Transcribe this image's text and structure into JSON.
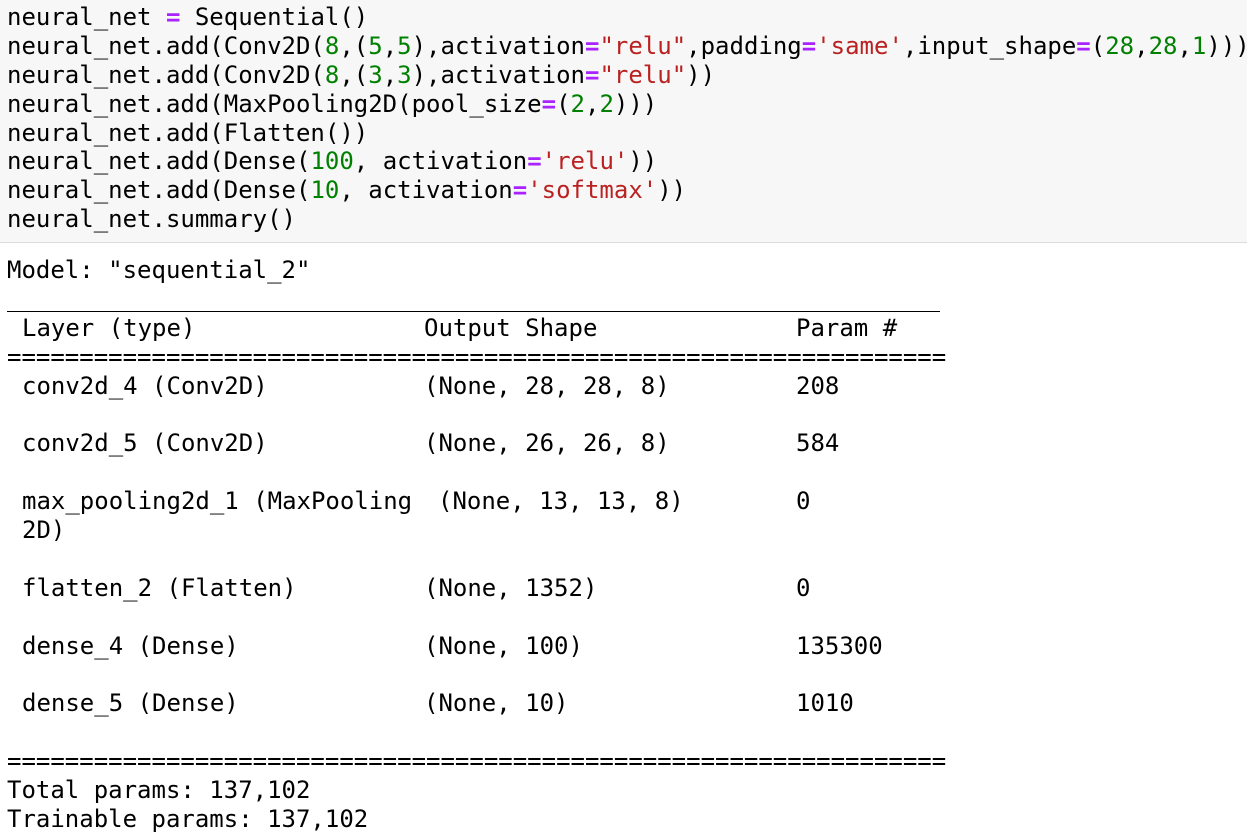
{
  "code": {
    "line1": {
      "a": "neural_net ",
      "op": "=",
      "b": " Sequential()"
    },
    "line2": {
      "p1": "neural_net.add(Conv2D(",
      "n1": "8",
      "p2": ",(",
      "n2": "5",
      "p3": ",",
      "n3": "5",
      "p4": "),activation",
      "op1": "=",
      "s1": "\"relu\"",
      "p5": ",padding",
      "op2": "=",
      "s2": "'same'",
      "p6": ",input_shape",
      "op3": "=",
      "p7": "(",
      "n4": "28",
      "p8": ",",
      "n5": "28",
      "p9": ",",
      "n6": "1",
      "p10": ")))"
    },
    "line3": {
      "p1": "neural_net.add(Conv2D(",
      "n1": "8",
      "p2": ",(",
      "n2": "3",
      "p3": ",",
      "n3": "3",
      "p4": "),activation",
      "op1": "=",
      "s1": "\"relu\"",
      "p5": "))"
    },
    "line4": {
      "p1": "neural_net.add(MaxPooling2D(pool_size",
      "op1": "=",
      "p2": "(",
      "n1": "2",
      "p3": ",",
      "n2": "2",
      "p4": ")))"
    },
    "line5": {
      "p1": "neural_net.add(Flatten())"
    },
    "line6": {
      "p1": "neural_net.add(Dense(",
      "n1": "100",
      "p2": ", activation",
      "op1": "=",
      "s1": "'relu'",
      "p3": "))"
    },
    "line7": {
      "p1": "neural_net.add(Dense(",
      "n1": "10",
      "p2": ", activation",
      "op1": "=",
      "s1": "'softmax'",
      "p3": "))"
    },
    "line8": {
      "p1": "neural_net.summary()"
    }
  },
  "output": {
    "model_line": "Model: \"sequential_2\"",
    "header": {
      "layer": "Layer (type)",
      "shape": "Output Shape",
      "params": "Param #"
    },
    "double_rule": "=================================================================",
    "rows": [
      {
        "layer": "conv2d_4 (Conv2D)",
        "shape": "(None, 28, 28, 8)",
        "params": "208"
      },
      {
        "layer": "conv2d_5 (Conv2D)",
        "shape": "(None, 26, 26, 8)",
        "params": "584"
      },
      {
        "layer": "max_pooling2d_1 (MaxPooling",
        "layer_cont": "2D)",
        "shape": "(None, 13, 13, 8)",
        "params": "0"
      },
      {
        "layer": "flatten_2 (Flatten)",
        "shape": "(None, 1352)",
        "params": "0"
      },
      {
        "layer": "dense_4 (Dense)",
        "shape": "(None, 100)",
        "params": "135300"
      },
      {
        "layer": "dense_5 (Dense)",
        "shape": "(None, 10)",
        "params": "1010"
      }
    ],
    "total_params": "Total params: 137,102",
    "trainable_params": "Trainable params: 137,102"
  }
}
